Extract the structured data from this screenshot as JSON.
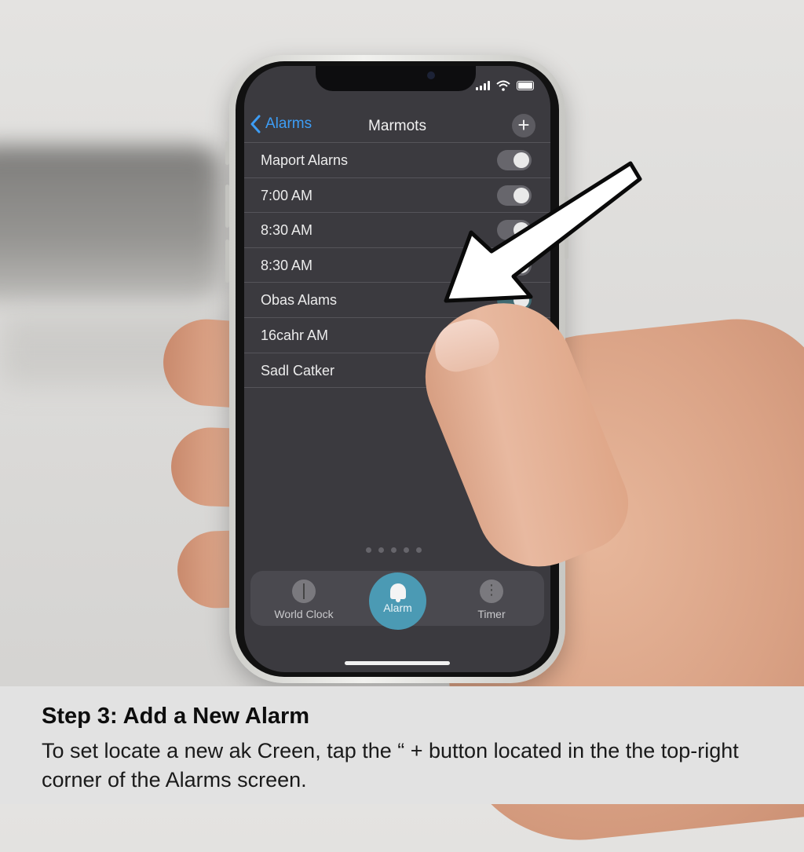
{
  "header": {
    "back_label": "Alarms",
    "title": "Marmots",
    "add_button_symbol": "+"
  },
  "alarms": [
    {
      "label": "Maport Alarns",
      "toggle": "on"
    },
    {
      "label": "7:00 AM",
      "toggle": "on"
    },
    {
      "label": "8:30 AM",
      "toggle": "on"
    },
    {
      "label": "8:30 AM",
      "toggle": "on"
    },
    {
      "label": "Obas Alams",
      "toggle": "on"
    },
    {
      "label": "16cahr AM"
    },
    {
      "label": "Sadl Catker"
    }
  ],
  "tabbar": {
    "world_clock": "World Clock",
    "alarm": "Alarm",
    "timer": "Timer",
    "active": "alarm"
  },
  "page_indicator_count": 5,
  "caption": {
    "title": "Step 3: Add a New Alarm",
    "body": "To set locate a new ak Creen, tap the “ + button located in the the top-right corner of the Alarms screen."
  },
  "colors": {
    "accent_blue": "#3d9df5",
    "screen_bg": "#3b3a3f",
    "alarm_tab": "#4b9ab4"
  },
  "icons": [
    "back-chevron-icon",
    "plus-icon",
    "signal-icon",
    "wifi-icon",
    "battery-icon",
    "world-clock-icon",
    "bell-icon",
    "timer-icon",
    "pointer-arrow-icon"
  ]
}
